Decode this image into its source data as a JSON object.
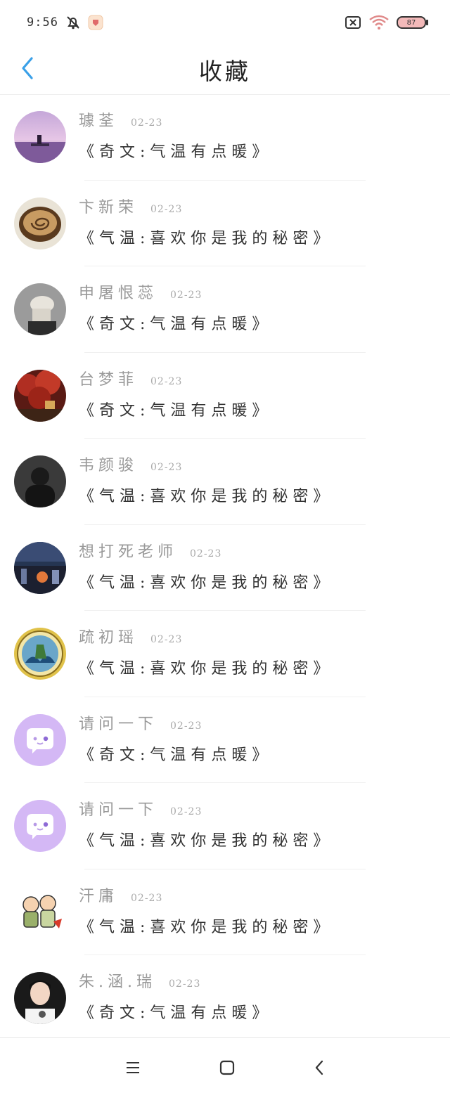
{
  "status_bar": {
    "time": "9:56",
    "battery": "87"
  },
  "header": {
    "title": "收藏"
  },
  "items": [
    {
      "name": "璩荃",
      "date": "02-23",
      "title": "《奇文:气温有点暖》",
      "avatar": "sunset-lake-avatar"
    },
    {
      "name": "卞新荣",
      "date": "02-23",
      "title": "《气温:喜欢你是我的秘密》",
      "avatar": "coffee-cup-avatar"
    },
    {
      "name": "申屠恨蕊",
      "date": "02-23",
      "title": "《奇文:气温有点暖》",
      "avatar": "hat-person-avatar"
    },
    {
      "name": "台梦菲",
      "date": "02-23",
      "title": "《奇文:气温有点暖》",
      "avatar": "red-tree-avatar"
    },
    {
      "name": "韦颜骏",
      "date": "02-23",
      "title": "《气温:喜欢你是我的秘密》",
      "avatar": "dark-hood-avatar"
    },
    {
      "name": "想打死老师",
      "date": "02-23",
      "title": "《气温:喜欢你是我的秘密》",
      "avatar": "night-city-avatar"
    },
    {
      "name": "疏初瑶",
      "date": "02-23",
      "title": "《气温:喜欢你是我的秘密》",
      "avatar": "emblem-avatar"
    },
    {
      "name": "请问一下",
      "date": "02-23",
      "title": "《奇文:气温有点暖》",
      "avatar": "chat-bubble-avatar"
    },
    {
      "name": "请问一下",
      "date": "02-23",
      "title": "《气温:喜欢你是我的秘密》",
      "avatar": "chat-bubble-avatar"
    },
    {
      "name": "汗庸",
      "date": "02-23",
      "title": "《气温:喜欢你是我的秘密》",
      "avatar": "cartoon-pair-avatar"
    },
    {
      "name": "朱.涵.瑞",
      "date": "02-23",
      "title": "《奇文:气温有点暖》",
      "avatar": "portrait-avatar"
    }
  ],
  "colors": {
    "accent": "#3aa0e8",
    "avatar_purple": "#d4b8f5"
  }
}
